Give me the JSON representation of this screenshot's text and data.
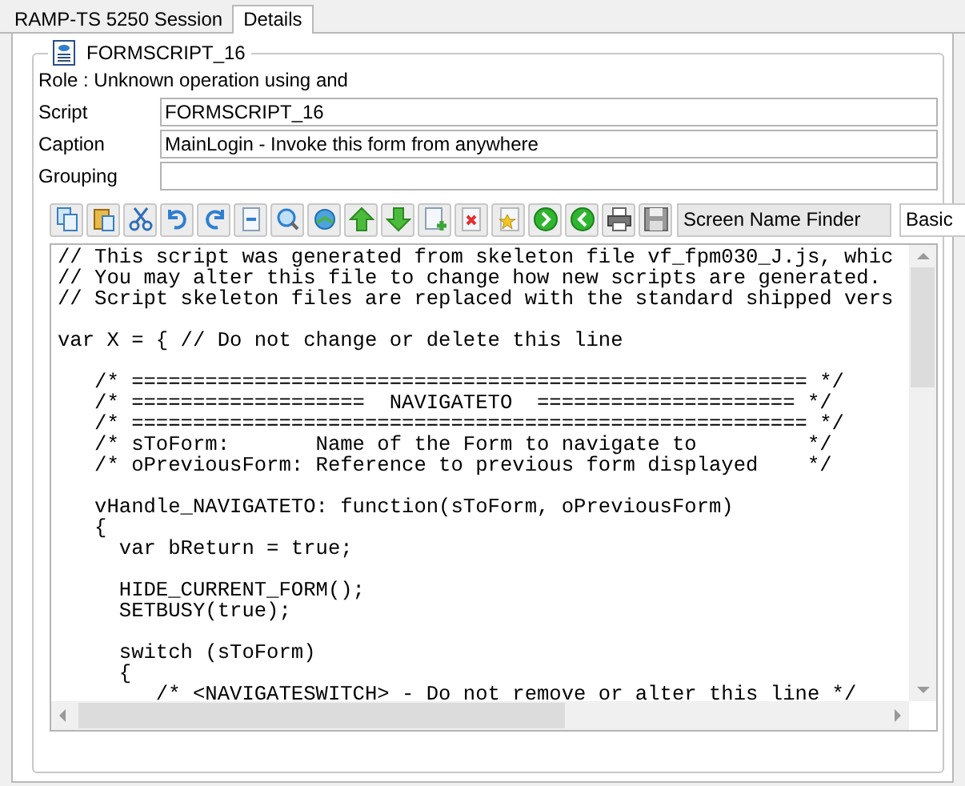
{
  "tabs": [
    {
      "label": "RAMP-TS 5250 Session",
      "selected": false
    },
    {
      "label": "Details",
      "selected": true
    }
  ],
  "group": {
    "title": "FORMSCRIPT_16",
    "role": "Role : Unknown operation using  and"
  },
  "fields": [
    {
      "label": "Script",
      "value": "FORMSCRIPT_16"
    },
    {
      "label": "Caption",
      "value": "MainLogin - Invoke this form from anywhere"
    },
    {
      "label": "Grouping"
    }
  ],
  "toolbar": {
    "finder": "Screen Name Finder",
    "mode": "Basic"
  },
  "code": [
    {
      "kind": "text",
      "text": "// This script was generated from skeleton file vf_fpm030_J.js, whic"
    },
    {
      "kind": "text",
      "text": "// You may alter this file to change how new scripts are generated."
    },
    {
      "kind": "text",
      "text": "// Script skeleton files are replaced with the standard shipped vers"
    },
    {
      "kind": "blank"
    },
    {
      "kind": "text",
      "text": "var X = { // Do not change or delete this line"
    },
    {
      "kind": "blank"
    },
    {
      "kind": "text",
      "text": "   /* ======================================================= */"
    },
    {
      "kind": "text",
      "text": "   /* ===================  NAVIGATETO  ===================== */"
    },
    {
      "kind": "text",
      "text": "   /* ======================================================= */"
    },
    {
      "kind": "text",
      "text": "   /* sToForm:       Name of the Form to navigate to         */"
    },
    {
      "kind": "text",
      "text": "   /* oPreviousForm: Reference to previous form displayed    */"
    },
    {
      "kind": "blank"
    },
    {
      "kind": "text",
      "text": "   vHandle_NAVIGATETO: function(sToForm, oPreviousForm)"
    },
    {
      "kind": "text",
      "text": "   {"
    },
    {
      "kind": "text",
      "text": "     var bReturn = true;"
    },
    {
      "kind": "blank"
    },
    {
      "kind": "text",
      "text": "     HIDE_CURRENT_FORM();"
    },
    {
      "kind": "text",
      "text": "     SETBUSY(true);"
    },
    {
      "kind": "blank"
    },
    {
      "kind": "text",
      "text": "     switch (sToForm)"
    },
    {
      "kind": "text",
      "text": "     {"
    },
    {
      "kind": "text",
      "text": "        /* <NAVIGATESWITCH> - Do not remove or alter this line */"
    }
  ]
}
